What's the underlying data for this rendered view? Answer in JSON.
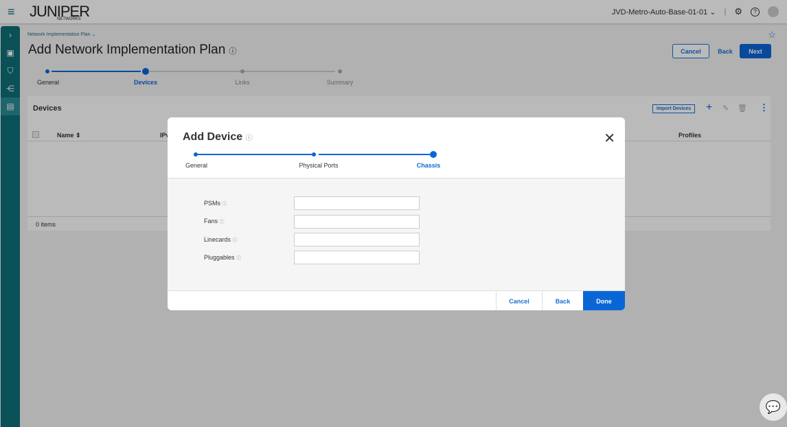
{
  "header": {
    "logo": "JUNIPER",
    "logo_sub": "NETWORKS",
    "site": "JVD-Metro-Auto-Base-01-01"
  },
  "breadcrumb": "Network Implementation Plan ⌄",
  "page_title": "Add Network Implementation Plan",
  "actions": {
    "cancel": "Cancel",
    "back": "Back",
    "next": "Next"
  },
  "wizard": {
    "steps": [
      "General",
      "Devices",
      "Links",
      "Summary"
    ],
    "current": 1
  },
  "devices_panel": {
    "title": "Devices",
    "import": "Import Devices",
    "columns": [
      "Name",
      "IPv",
      "Profiles"
    ],
    "footer": "0 items"
  },
  "modal": {
    "title": "Add Device",
    "steps": [
      "General",
      "Physical Ports",
      "Chassis"
    ],
    "current": 2,
    "fields": [
      {
        "label": "PSMs",
        "value": ""
      },
      {
        "label": "Fans",
        "value": ""
      },
      {
        "label": "Linecards",
        "value": ""
      },
      {
        "label": "Pluggables",
        "value": ""
      }
    ],
    "cancel": "Cancel",
    "back": "Back",
    "done": "Done"
  },
  "colors": {
    "accent": "#0a66d6",
    "sidebar": "#0e6e78"
  }
}
